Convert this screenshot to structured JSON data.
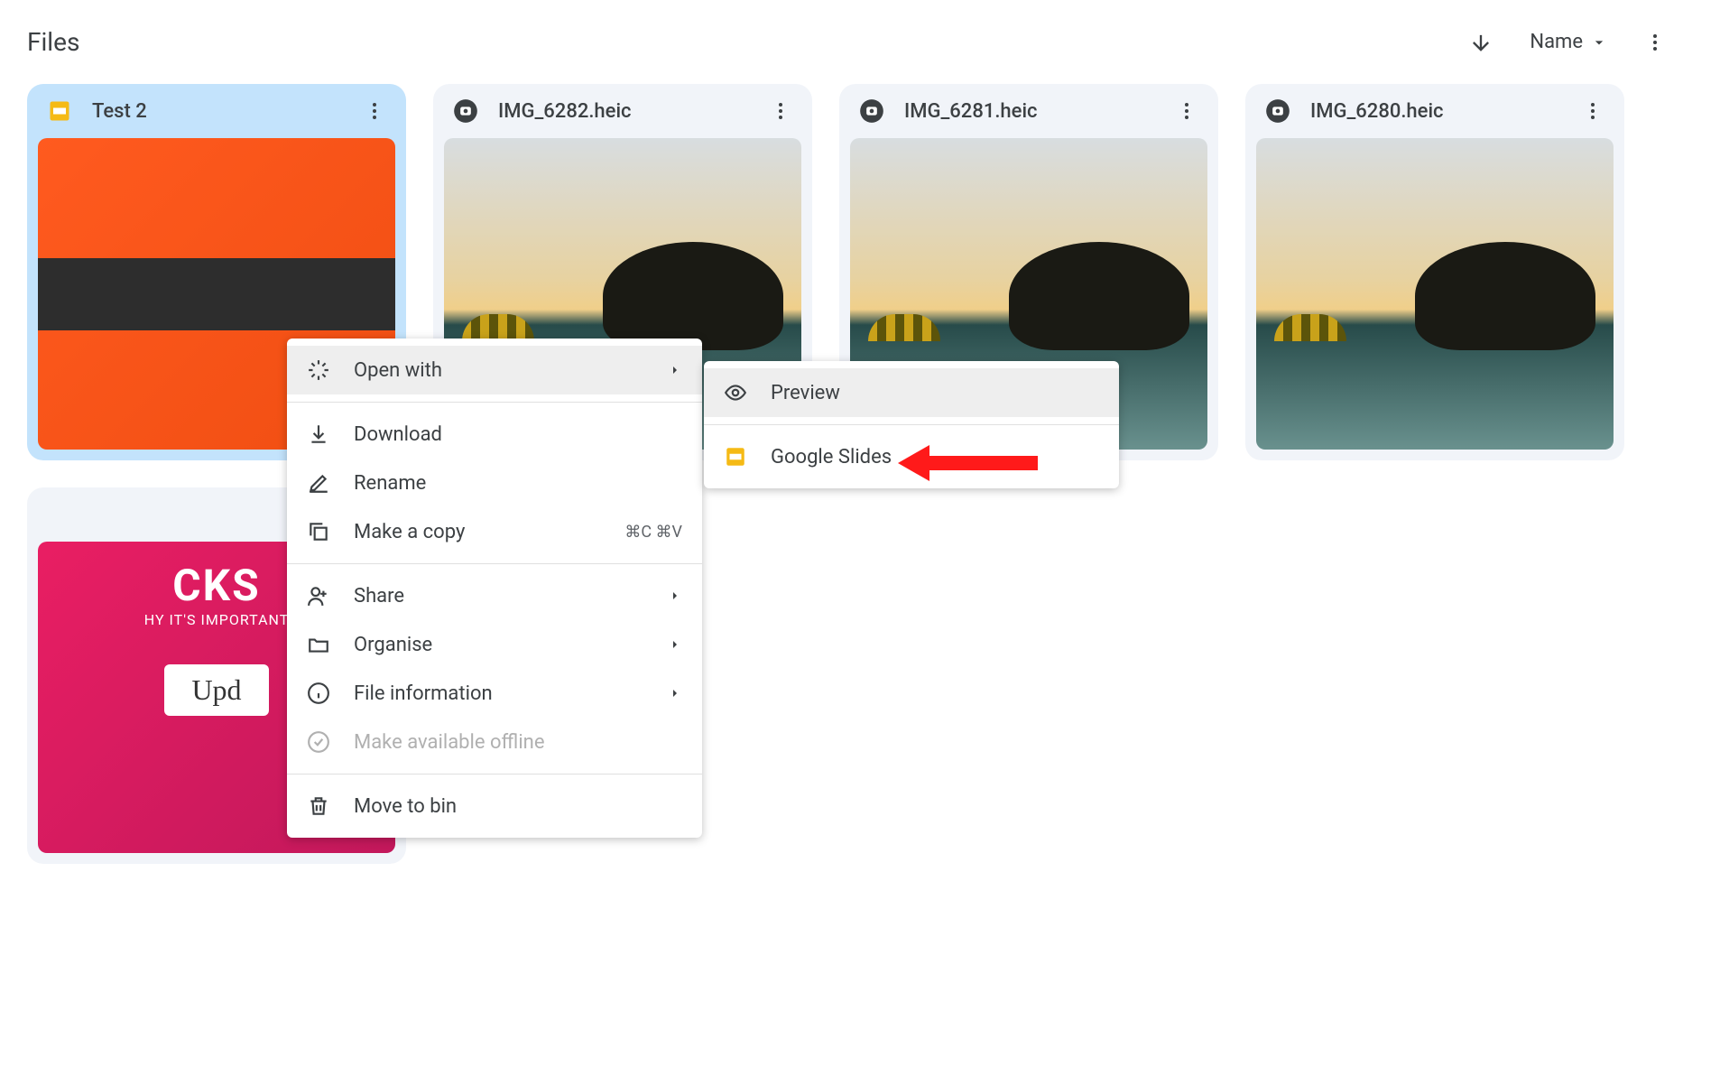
{
  "header": {
    "title": "Files",
    "sort_label": "Name"
  },
  "files": [
    {
      "name": "Test 2",
      "type": "slides",
      "selected": true
    },
    {
      "name": "IMG_6282.heic",
      "type": "image",
      "selected": false
    },
    {
      "name": "IMG_6281.heic",
      "type": "image",
      "selected": false
    },
    {
      "name": "IMG_6280.heic",
      "type": "image",
      "selected": false
    },
    {
      "name": "",
      "type": "image",
      "selected": false
    }
  ],
  "context_menu": {
    "open_with": "Open with",
    "download": "Download",
    "rename": "Rename",
    "make_copy": "Make a copy",
    "make_copy_shortcut": "⌘C ⌘V",
    "share": "Share",
    "organise": "Organise",
    "file_info": "File information",
    "offline": "Make available offline",
    "bin": "Move to bin"
  },
  "submenu": {
    "preview": "Preview",
    "google_slides": "Google Slides"
  },
  "thumb5": {
    "line1": "CKS",
    "line2": "HY IT'S IMPORTANT",
    "line3": "Upd"
  }
}
